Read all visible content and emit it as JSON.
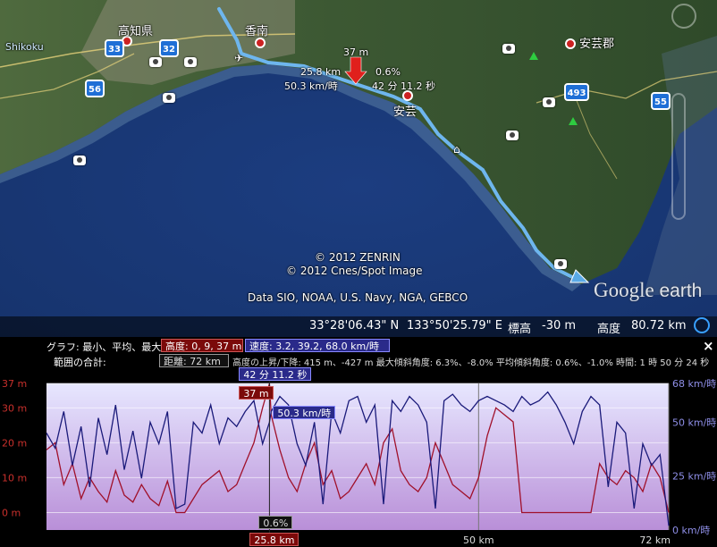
{
  "map": {
    "places": {
      "shikoku": "Shikoku",
      "kochi_pref": "高知県",
      "konan": "香南",
      "aki": "安芸",
      "aki_district": "安芸郡"
    },
    "routes": [
      "33",
      "32",
      "56",
      "493",
      "55"
    ],
    "marker": {
      "height": "37 m",
      "distance": "25.8 km",
      "speed": "50.3 km/時",
      "slope": "0.6%",
      "time": "42 分 11.2 秒"
    },
    "credits": {
      "line1": "© 2012 ZENRIN",
      "line2": "© 2012 Cnes/Spot Image",
      "line3": "Data SIO, NOAA, U.S. Navy, NGA, GEBCO"
    },
    "logo_word1": "Google",
    "logo_word2": "earth",
    "status": {
      "lat": "33°28'06.43\" N",
      "lon": "133°50'25.79\" E",
      "elev_label": "標高",
      "elev_value": "-30 m",
      "alt_label": "高度",
      "alt_value": "80.72 km"
    }
  },
  "profile": {
    "graph_label": "グラフ: 最小、平均、最大",
    "elev_stats": "高度: 0, 9, 37 m",
    "speed_stats": "速度: 3.2, 39.2, 68.0 km/時",
    "range_label": "範囲の合計:",
    "distance_stats": "距離: 72 km",
    "summary": "高度の上昇/下降: 415 m、-427 m   最大傾斜角度: 6.3%、-8.0%   平均傾斜角度: 0.6%、-1.0%   時間: 1 時 50 分 24 秒",
    "close": "×",
    "cursor": {
      "time": "42 分 11.2 秒",
      "elev": "37 m",
      "speed": "50.3 km/時",
      "slope": "0.6%",
      "distance": "25.8 km",
      "x_km": 25.8
    }
  },
  "chart_data": {
    "type": "line",
    "x_unit": "km",
    "xlim": [
      0,
      72
    ],
    "x_ticks": [
      {
        "value": 50,
        "label": "50 km"
      },
      {
        "value": 72,
        "label": "72 km"
      }
    ],
    "y_left": {
      "ylim": [
        -5,
        37
      ],
      "ticks": [
        {
          "value": 37,
          "label": "37 m"
        },
        {
          "value": 30,
          "label": "30 m"
        },
        {
          "value": 20,
          "label": "20 m"
        },
        {
          "value": 10,
          "label": "10 m"
        },
        {
          "value": 0,
          "label": "0 m"
        }
      ]
    },
    "y_right": {
      "ylim": [
        0,
        68
      ],
      "ticks": [
        {
          "value": 68,
          "label": "68 km/時"
        },
        {
          "value": 50,
          "label": "50 km/時"
        },
        {
          "value": 25,
          "label": "25 km/時"
        },
        {
          "value": 0,
          "label": "0 km/時"
        }
      ]
    },
    "series": [
      {
        "name": "高度",
        "axis": "left",
        "color": "#a0102a",
        "x": [
          0,
          1,
          2,
          3,
          4,
          5,
          6,
          7,
          8,
          9,
          10,
          11,
          12,
          13,
          14,
          15,
          16,
          17,
          18,
          19,
          20,
          21,
          22,
          23,
          24,
          25,
          25.8,
          26,
          27,
          28,
          29,
          30,
          31,
          32,
          33,
          34,
          35,
          36,
          37,
          38,
          39,
          40,
          41,
          42,
          43,
          44,
          45,
          46,
          47,
          48,
          49,
          50,
          51,
          52,
          53,
          54,
          55,
          56,
          57,
          58,
          59,
          60,
          61,
          62,
          63,
          64,
          65,
          66,
          67,
          68,
          69,
          70,
          71,
          72
        ],
        "y": [
          18,
          20,
          8,
          14,
          4,
          10,
          6,
          3,
          12,
          5,
          3,
          8,
          4,
          2,
          9,
          0,
          0,
          4,
          8,
          10,
          12,
          6,
          8,
          14,
          20,
          30,
          37,
          28,
          18,
          10,
          6,
          14,
          20,
          8,
          12,
          4,
          6,
          10,
          14,
          8,
          20,
          24,
          12,
          8,
          6,
          10,
          20,
          14,
          8,
          6,
          4,
          10,
          22,
          30,
          28,
          26,
          0,
          0,
          0,
          0,
          0,
          0,
          0,
          0,
          0,
          14,
          10,
          8,
          12,
          10,
          6,
          14,
          10,
          0
        ]
      },
      {
        "name": "速度",
        "axis": "right",
        "color": "#1a1a7a",
        "x": [
          0,
          1,
          2,
          3,
          4,
          5,
          6,
          7,
          8,
          9,
          10,
          11,
          12,
          13,
          14,
          15,
          16,
          17,
          18,
          19,
          20,
          21,
          22,
          23,
          24,
          25,
          25.8,
          26,
          27,
          28,
          29,
          30,
          31,
          32,
          33,
          34,
          35,
          36,
          37,
          38,
          39,
          40,
          41,
          42,
          43,
          44,
          45,
          46,
          47,
          48,
          49,
          50,
          51,
          52,
          53,
          54,
          55,
          56,
          57,
          58,
          59,
          60,
          61,
          62,
          63,
          64,
          65,
          66,
          67,
          68,
          69,
          70,
          71,
          72
        ],
        "y": [
          45,
          38,
          55,
          30,
          48,
          20,
          52,
          35,
          58,
          28,
          46,
          24,
          50,
          40,
          55,
          10,
          12,
          50,
          45,
          58,
          40,
          52,
          48,
          55,
          60,
          40,
          50,
          55,
          62,
          58,
          40,
          30,
          50,
          12,
          55,
          45,
          60,
          62,
          50,
          58,
          12,
          60,
          55,
          62,
          58,
          50,
          10,
          60,
          63,
          58,
          55,
          60,
          62,
          60,
          58,
          55,
          62,
          58,
          60,
          64,
          58,
          50,
          40,
          55,
          62,
          58,
          20,
          50,
          45,
          10,
          40,
          30,
          35,
          2
        ]
      }
    ]
  }
}
